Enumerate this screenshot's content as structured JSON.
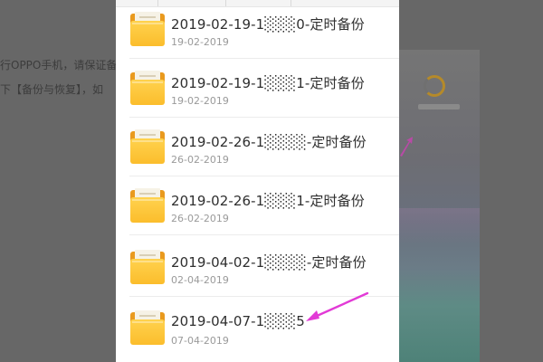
{
  "background": {
    "text_line_1": "行OPPO手机，请保证备",
    "text_line_2": "下【备份与恢复】，如"
  },
  "file_list": {
    "items": [
      {
        "name": "2019-02-19-1░░░0-定时备份",
        "date": "19-02-2019",
        "icon": "folder-icon"
      },
      {
        "name": "2019-02-19-1░░░1-定时备份",
        "date": "19-02-2019",
        "icon": "folder-icon"
      },
      {
        "name": "2019-02-26-1░░░░-定时备份",
        "date": "26-02-2019",
        "icon": "folder-icon"
      },
      {
        "name": "2019-02-26-1░░░1-定时备份",
        "date": "26-02-2019",
        "icon": "folder-icon"
      },
      {
        "name": "2019-04-02-1░░░░-定时备份",
        "date": "02-04-2019",
        "icon": "folder-icon"
      },
      {
        "name": "2019-04-07-1░░░5",
        "date": "07-04-2019",
        "icon": "folder-icon"
      }
    ]
  },
  "colors": {
    "folder_front": "#fbbd2c",
    "folder_back": "#e99a1e",
    "arrow": "#e23ad6",
    "list_background": "#ffffff",
    "overlay": "#676767"
  }
}
